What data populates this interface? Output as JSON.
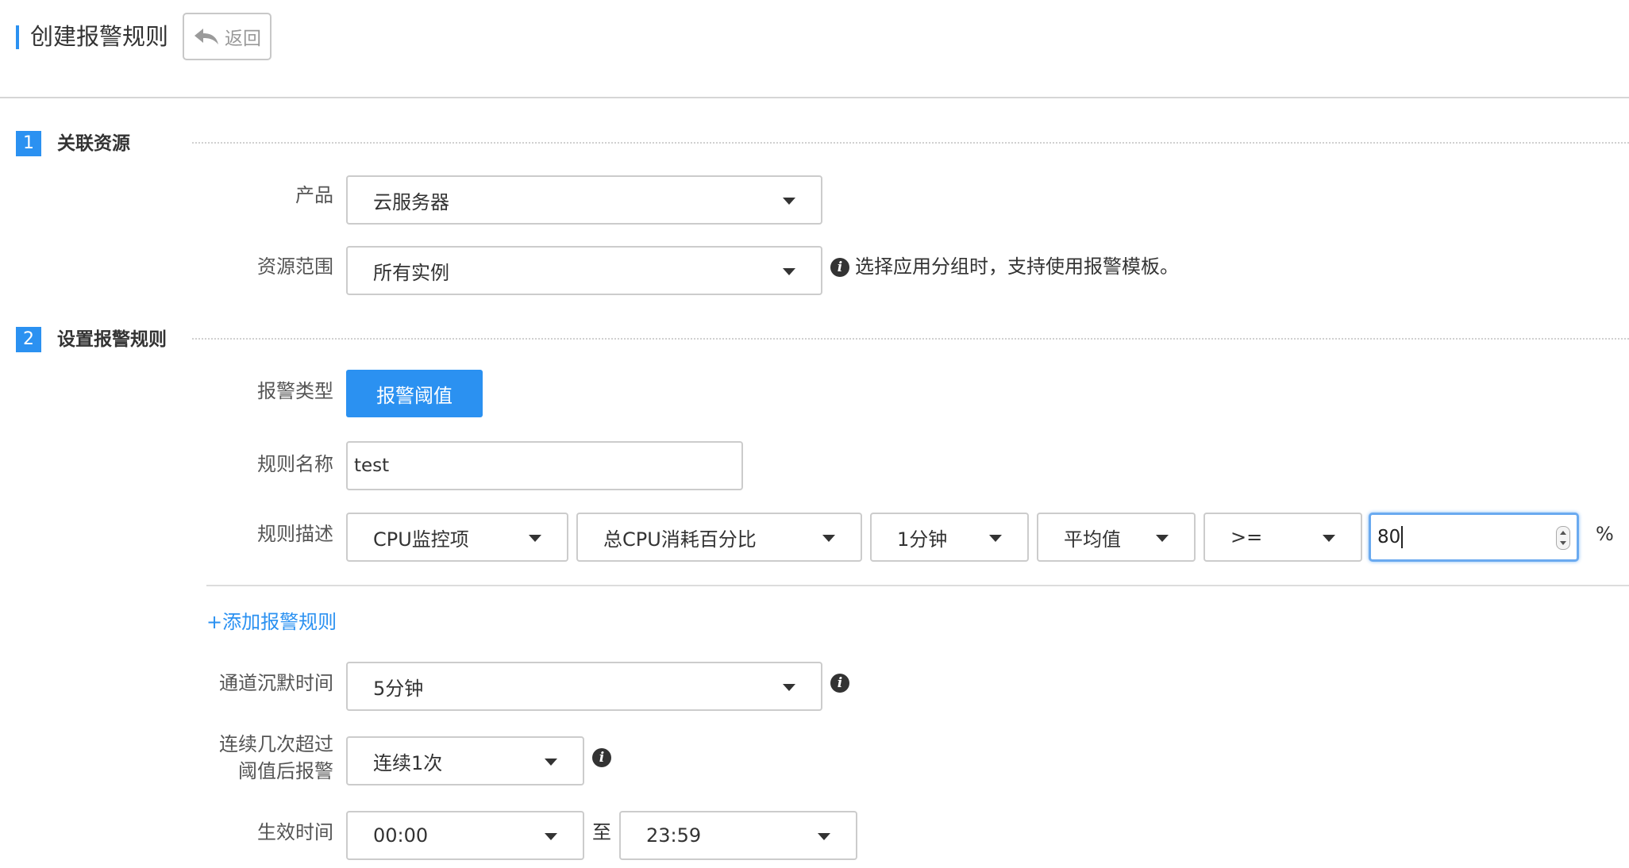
{
  "header": {
    "title": "创建报警规则",
    "back_label": "返回"
  },
  "section1": {
    "number": "1",
    "title": "关联资源",
    "product": {
      "label": "产品",
      "value": "云服务器"
    },
    "scope": {
      "label": "资源范围",
      "value": "所有实例",
      "hint": "选择应用分组时，支持使用报警模板。"
    }
  },
  "section2": {
    "number": "2",
    "title": "设置报警规则",
    "alarm_type": {
      "label": "报警类型",
      "value": "报警阈值"
    },
    "rule_name": {
      "label": "规则名称",
      "value": "test"
    },
    "rule_desc": {
      "label": "规则描述",
      "metric_group": "CPU监控项",
      "metric": "总CPU消耗百分比",
      "period": "1分钟",
      "statistic": "平均值",
      "operator": ">=",
      "threshold": "80",
      "unit": "%"
    },
    "add_rule_link": "+添加报警规则",
    "silence": {
      "label": "通道沉默时间",
      "value": "5分钟"
    },
    "consecutive": {
      "label_line1": "连续几次超过",
      "label_line2": "阈值后报警",
      "value": "连续1次"
    },
    "effective": {
      "label": "生效时间",
      "start": "00:00",
      "separator": "至",
      "end": "23:59"
    }
  },
  "icons": {
    "back": "reply-arrow-icon",
    "info": "info-icon",
    "dropdown": "caret-down-icon"
  },
  "colors": {
    "accent": "#2b91f1"
  }
}
